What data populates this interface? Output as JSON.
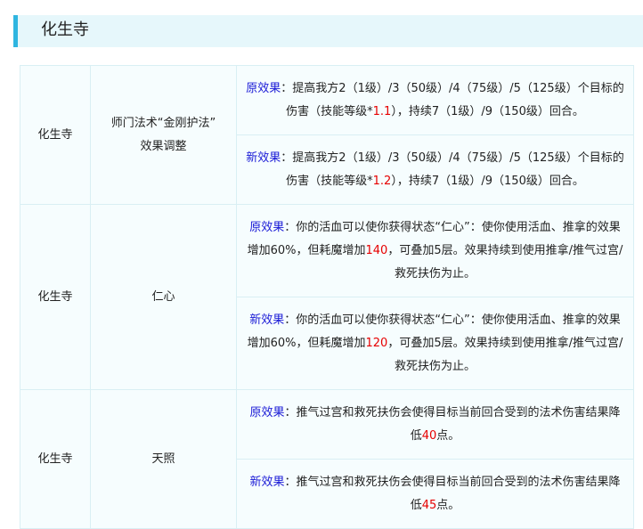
{
  "section": {
    "title": "化生寺"
  },
  "rows": [
    {
      "school": "化生寺",
      "skill_lines": [
        "师门法术“金刚护法”",
        "效果调整"
      ],
      "old": {
        "label": "原效果",
        "p1": "：提高我方2（1级）/3（50级）/4（75级）/5（125级）个目标的伤害（技能等级*",
        "num": "1.1",
        "p2": "），持续7（1级）/9（150级）回合。"
      },
      "new": {
        "label": "新效果",
        "p1": "：提高我方2（1级）/3（50级）/4（75级）/5（125级）个目标的伤害（技能等级*",
        "num": "1.2",
        "p2": "），持续7（1级）/9（150级）回合。"
      }
    },
    {
      "school": "化生寺",
      "skill_lines": [
        "仁心"
      ],
      "old": {
        "label": "原效果",
        "p1": "：你的活血可以使你获得状态“仁心”：使你使用活血、推拿的效果增加60%，但耗魔增加",
        "num": "140",
        "p2": "，可叠加5层。效果持续到使用推拿/推气过宫/救死扶伤为止。"
      },
      "new": {
        "label": "新效果",
        "p1": "：你的活血可以使你获得状态“仁心”：使你使用活血、推拿的效果增加60%，但耗魔增加",
        "num": "120",
        "p2": "，可叠加5层。效果持续到使用推拿/推气过宫/救死扶伤为止。"
      }
    },
    {
      "school": "化生寺",
      "skill_lines": [
        "天照"
      ],
      "old": {
        "label": "原效果",
        "p1": "：推气过宫和救死扶伤会使得目标当前回合受到的法术伤害结果降低",
        "num": "40",
        "p2": "点。"
      },
      "new": {
        "label": "新效果",
        "p1": "：推气过宫和救死扶伤会使得目标当前回合受到的法术伤害结果降低",
        "num": "45",
        "p2": "点。"
      }
    }
  ]
}
